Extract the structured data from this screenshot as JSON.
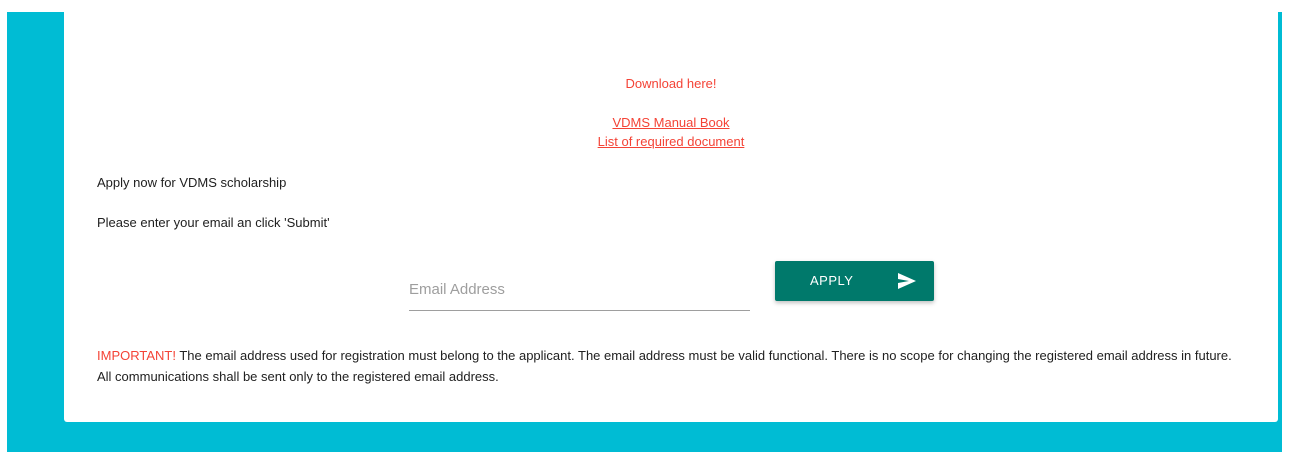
{
  "download": {
    "title": "Download here!",
    "links": [
      "VDMS Manual Book",
      "List of required document"
    ]
  },
  "form": {
    "heading": "Apply now for VDMS scholarship",
    "instruction": "Please enter your email an click 'Submit'",
    "email_placeholder": "Email Address",
    "email_value": "",
    "apply_label": "APPLY",
    "apply_icon": "send-icon"
  },
  "notice": {
    "important_label": "IMPORTANT!",
    "text": " The email address used for registration must belong to the applicant. The email address must be valid functional. There is no scope for changing the registered email address in future. All communications shall be sent only to the registered email address."
  },
  "colors": {
    "frame": "#00bcd4",
    "accent_red": "#f44336",
    "button": "#00796b"
  }
}
